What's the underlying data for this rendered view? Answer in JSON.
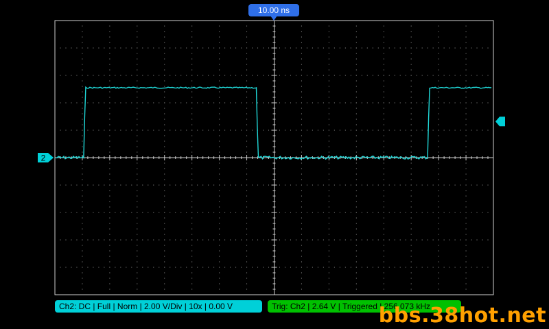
{
  "timebase": {
    "label": "10.00 ns"
  },
  "channel": {
    "marker": "2",
    "status": "Ch2: DC | Full | Norm | 2.00 V/Div | 10x | 0.00 V"
  },
  "trigger": {
    "status": "Trig: Ch2 | 2.64 V | Triggered | 256.073 kHz"
  },
  "watermark": "bbs.38hot.net",
  "colors": {
    "background": "#000000",
    "grid": "#9a9a9a",
    "frame": "#d0d0d0",
    "trace": "#20d8d8",
    "channel_badge": "#00d0d8",
    "trigger_badge": "#00c000",
    "timebase_badge": "#2f6fe8",
    "watermark": "#ffa000"
  },
  "waveform": {
    "type": "square",
    "time_per_div_ns": 10,
    "volts_per_div": 2.0,
    "low_level_div": 0.0,
    "high_level_div": 2.55,
    "rising_edges_div": [
      -6.95,
      5.6
    ],
    "falling_edges_div": [
      -0.65
    ],
    "trigger_level_div": 1.32
  }
}
